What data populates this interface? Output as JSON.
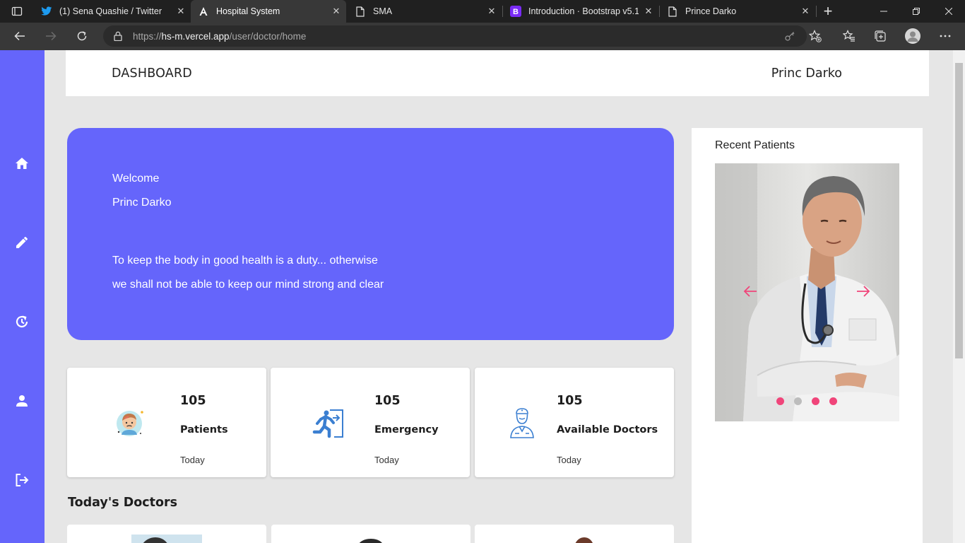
{
  "browser": {
    "tabs": [
      {
        "title": "(1) Sena Quashie / Twitter",
        "icon": "twitter-icon",
        "active": false
      },
      {
        "title": "Hospital System",
        "icon": "angular-icon",
        "active": true
      },
      {
        "title": "SMA",
        "icon": "page-icon",
        "active": false
      },
      {
        "title": "Introduction · Bootstrap v5.1",
        "icon": "bootstrap-icon",
        "active": false
      },
      {
        "title": "Prince Darko",
        "icon": "page-icon",
        "active": false
      }
    ],
    "url_prefix": "https://",
    "url_host": "hs-m.vercel.app",
    "url_path": "/user/doctor/home"
  },
  "header": {
    "title": "DASHBOARD",
    "user": "Princ Darko"
  },
  "sidebar": {
    "items": [
      "home-icon",
      "edit-icon",
      "history-icon",
      "person-icon",
      "logout-icon"
    ]
  },
  "welcome": {
    "greeting": "Welcome",
    "name": "Princ Darko",
    "quote_line1": "To keep the body in good health is a duty... otherwise",
    "quote_line2": "we shall not be able to keep our mind strong and clear"
  },
  "stats": [
    {
      "value": "105",
      "label": "Patients",
      "period": "Today",
      "icon": "patient-icon"
    },
    {
      "value": "105",
      "label": "Emergency",
      "period": "Today",
      "icon": "emergency-exit-icon"
    },
    {
      "value": "105",
      "label": "Available Doctors",
      "period": "Today",
      "icon": "doctor-icon"
    }
  ],
  "doctors_section": {
    "title": "Today's Doctors"
  },
  "recent": {
    "title": "Recent Patients",
    "dots_total": 4,
    "active_dot": 1
  },
  "colors": {
    "accent": "#6565fb",
    "carousel_accent": "#f0457a"
  }
}
